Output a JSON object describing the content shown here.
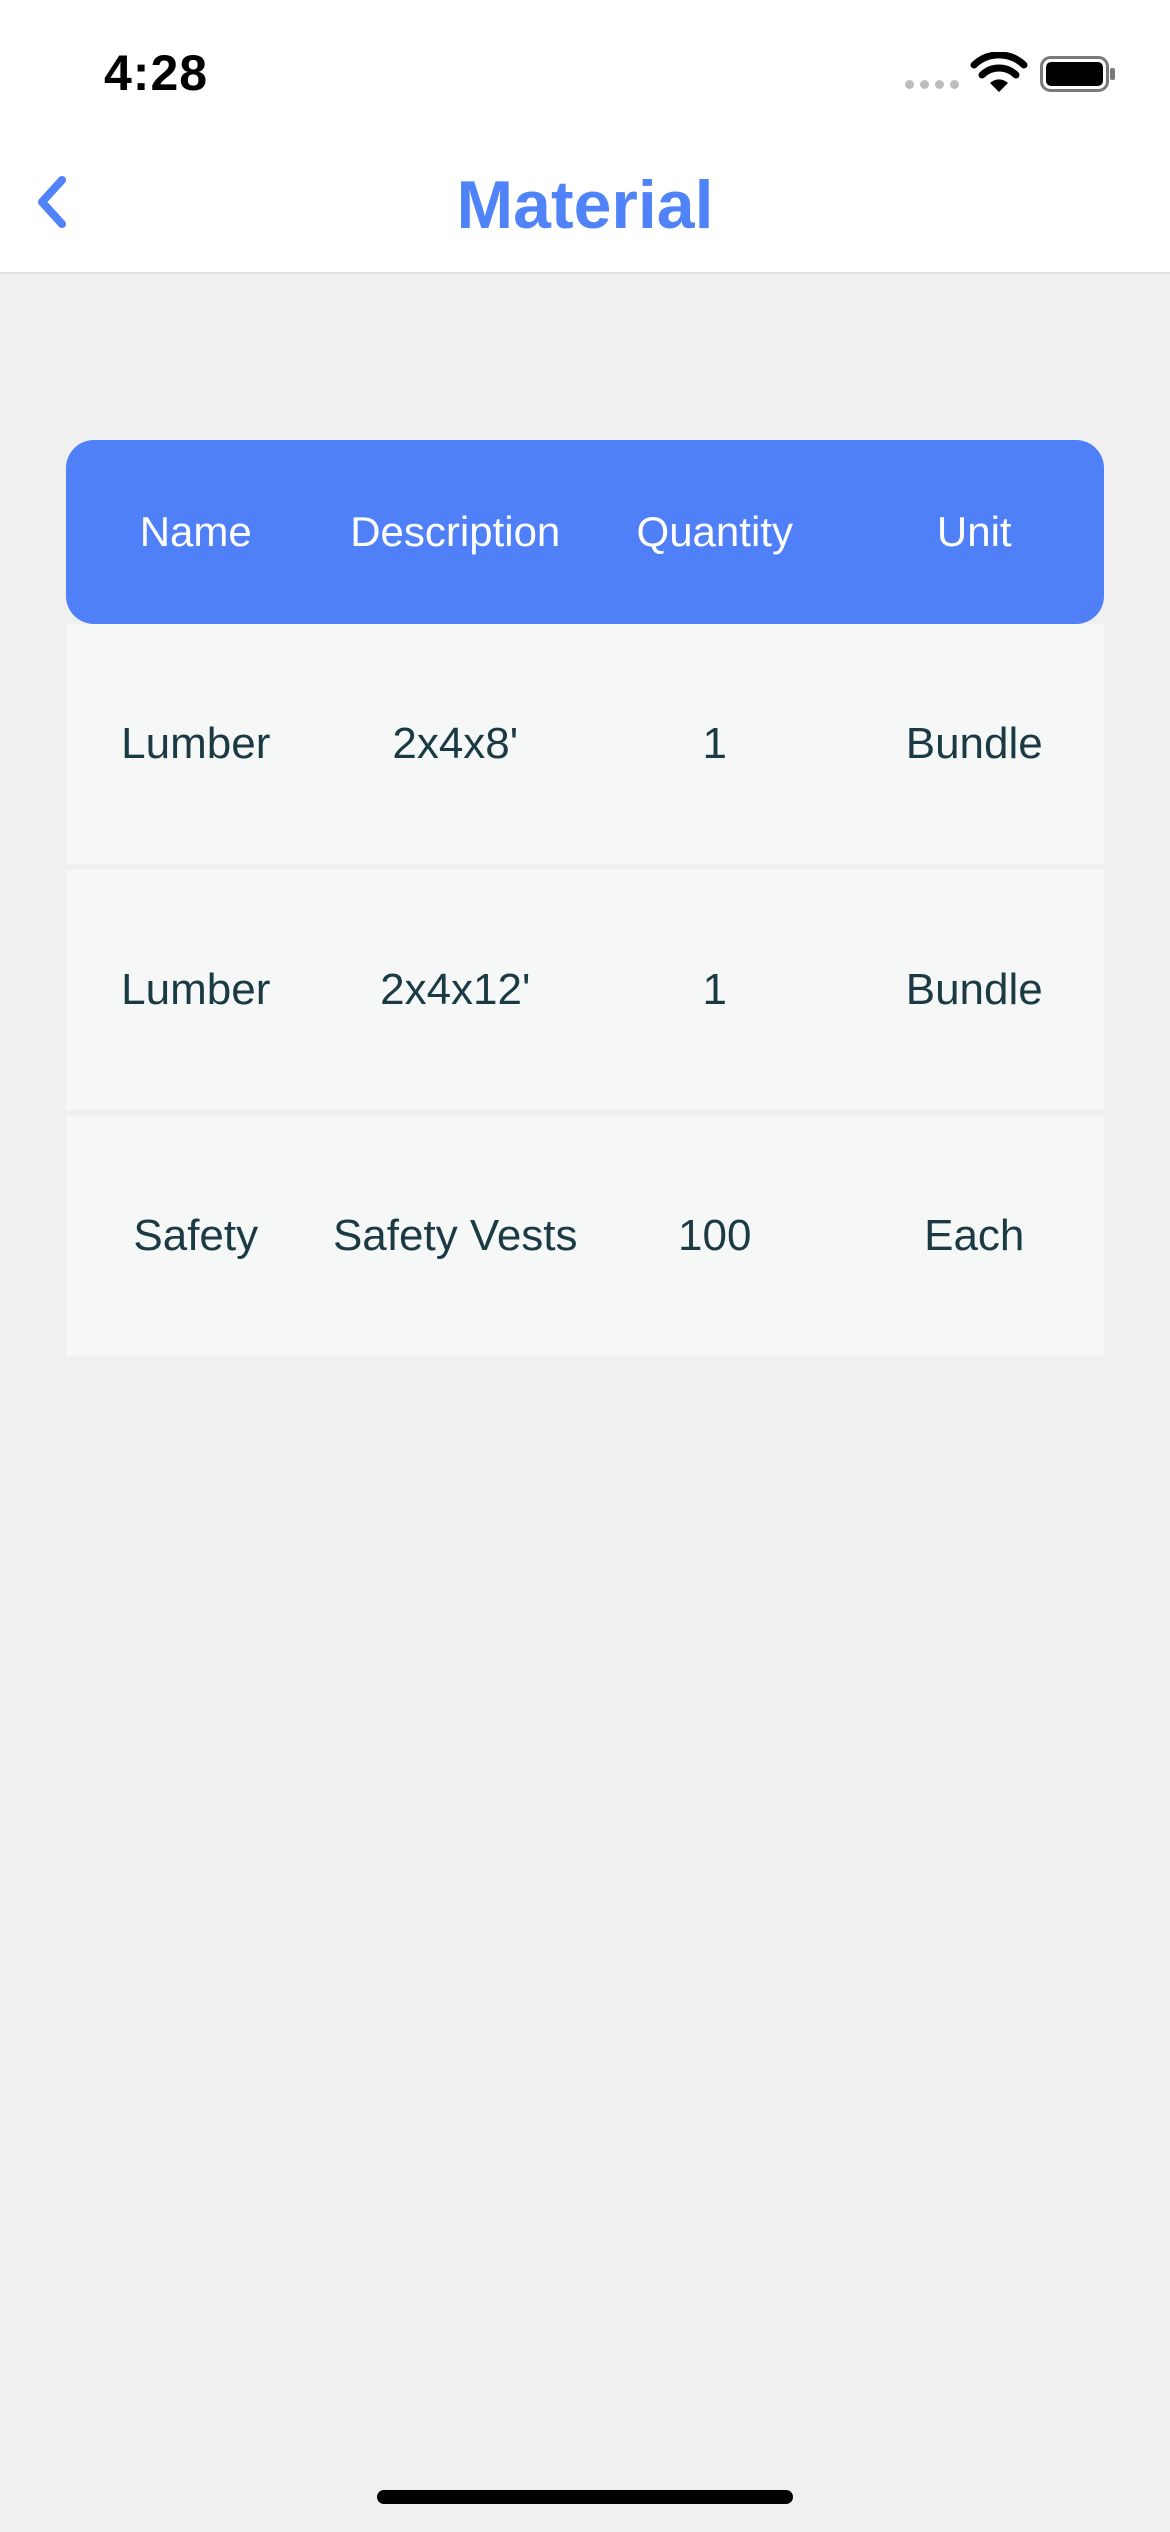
{
  "status_bar": {
    "time": "4:28"
  },
  "nav": {
    "title": "Material",
    "back_icon": "chevron-left-icon",
    "accent_color": "#5082f8"
  },
  "table": {
    "header_color": "#5080f8",
    "columns": [
      "Name",
      "Description",
      "Quantity",
      "Unit"
    ],
    "rows": [
      [
        "Lumber",
        "2x4x8'",
        "1",
        "Bundle"
      ],
      [
        "Lumber",
        "2x4x12'",
        "1",
        "Bundle"
      ],
      [
        "Safety",
        "Safety Vests",
        "100",
        "Each"
      ]
    ]
  }
}
